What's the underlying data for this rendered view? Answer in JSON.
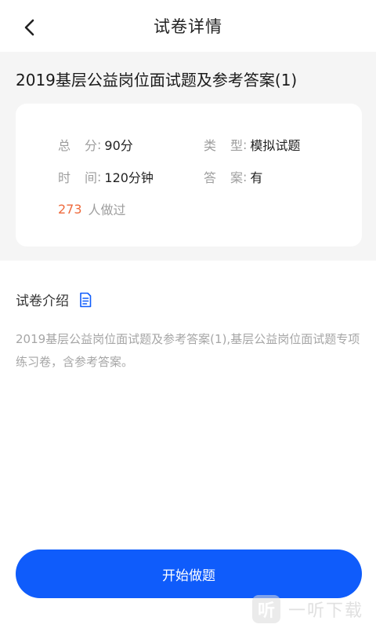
{
  "nav": {
    "back_icon": "chevron-left-icon",
    "title": "试卷详情"
  },
  "paper": {
    "title": "2019基层公益岗位面试题及参考答案(1)"
  },
  "info": {
    "total_score_label_1": "总",
    "total_score_label_2": "分",
    "total_score_value": "90分",
    "type_label_1": "类",
    "type_label_2": "型",
    "type_value": "模拟试题",
    "time_label_1": "时",
    "time_label_2": "间",
    "time_value": "120分钟",
    "answer_label_1": "答",
    "answer_label_2": "案",
    "answer_value": "有",
    "colon": ":",
    "participants_count": "273",
    "participants_suffix": "人做过"
  },
  "intro": {
    "heading": "试卷介绍",
    "icon": "document-icon",
    "text": "2019基层公益岗位面试题及参考答案(1),基层公益岗位面试题专项练习卷，含参考答案。"
  },
  "actions": {
    "start_label": "开始做题"
  },
  "watermark": {
    "logo_char": "听",
    "text": "一听下载"
  },
  "colors": {
    "primary": "#0f5cfb",
    "accent_count": "#ee6a3c",
    "section_bg": "#f5f5f5"
  }
}
